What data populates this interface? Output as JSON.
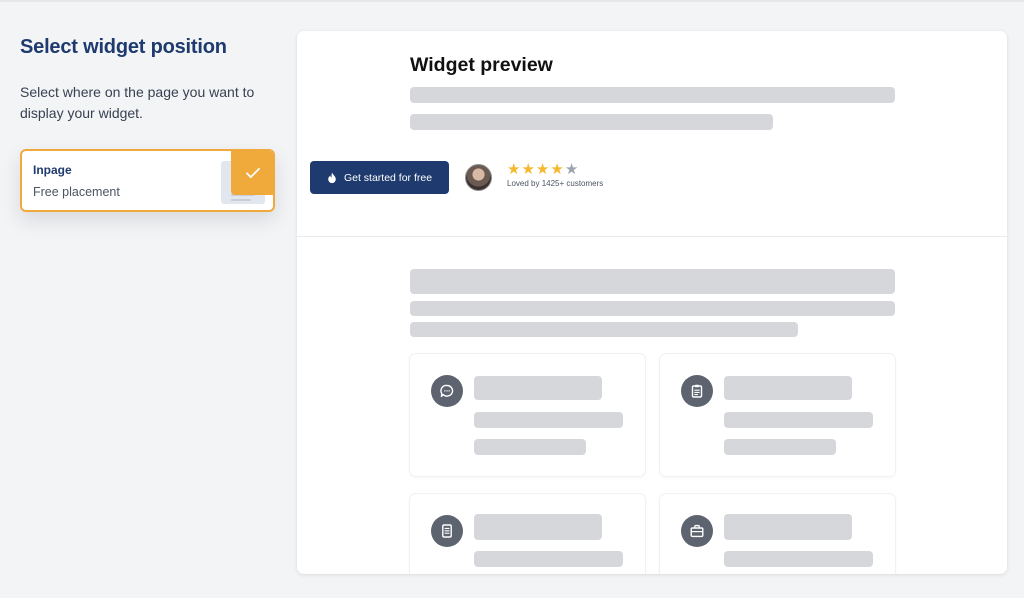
{
  "left": {
    "title": "Select widget position",
    "description": "Select where on the page you want to display your widget.",
    "option": {
      "title": "Inpage",
      "subtitle": "Free placement",
      "selected": true,
      "accent_color": "#f0a93b"
    }
  },
  "preview": {
    "title": "Widget preview",
    "cta_label": "Get started for free",
    "cta_icon": "fire-icon",
    "rating": {
      "filled_stars": 4,
      "total_stars": 5,
      "star_color": "#f5b82e"
    },
    "loved_text": "Loved by 1425+ customers",
    "features": [
      {
        "icon": "chat-bubble-icon"
      },
      {
        "icon": "clipboard-icon"
      },
      {
        "icon": "document-icon"
      },
      {
        "icon": "briefcase-icon"
      }
    ]
  },
  "colors": {
    "brand_navy": "#1e3a6e",
    "accent_orange": "#f0a93b",
    "placeholder_gray": "#d6d7da",
    "icon_gray": "#5d6470"
  }
}
